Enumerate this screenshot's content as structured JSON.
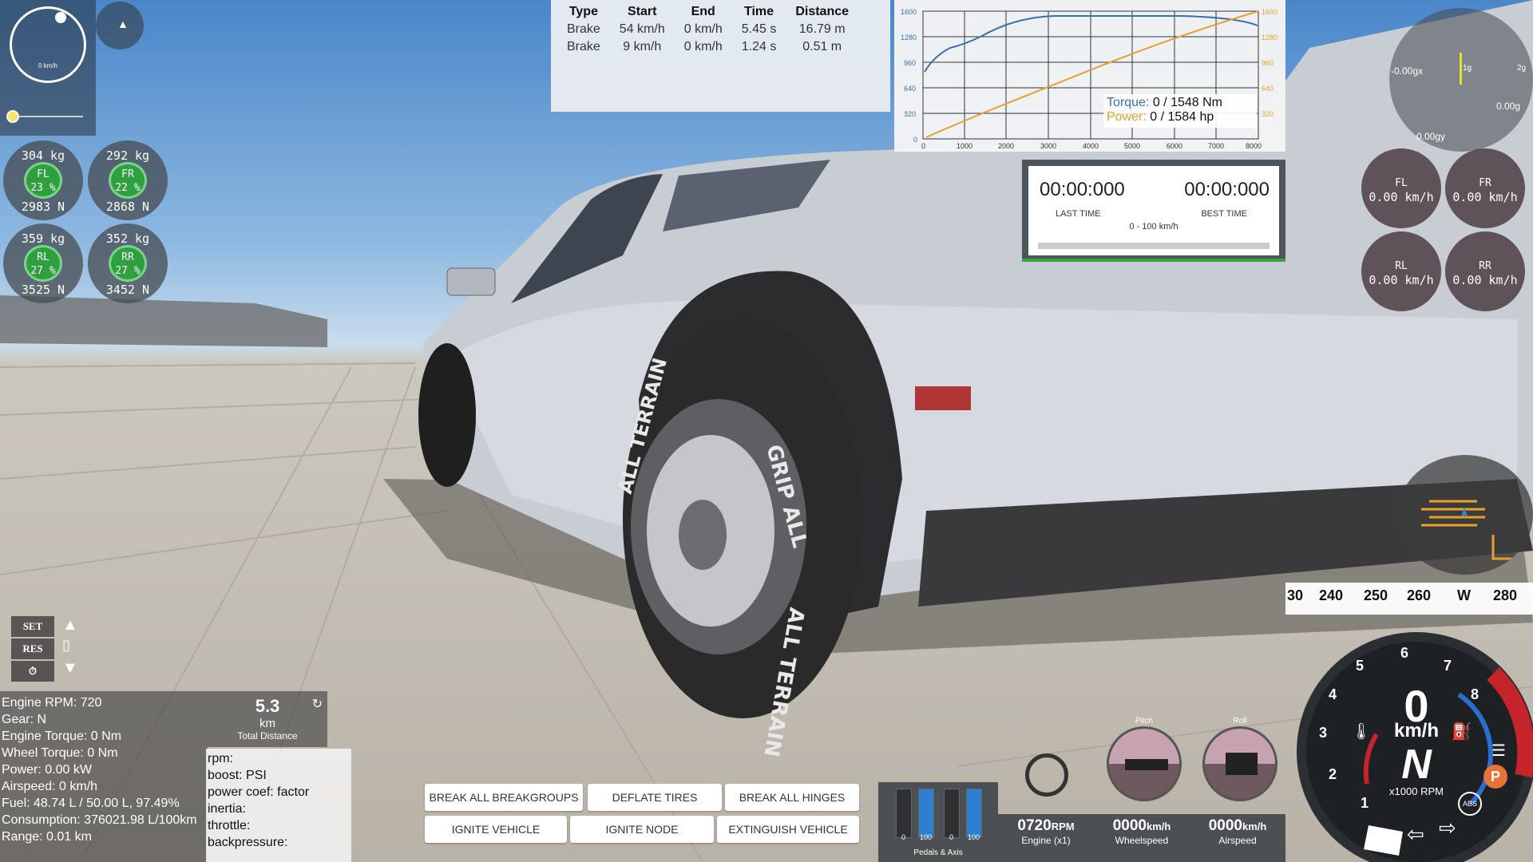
{
  "minimap": {
    "speed_label": "0 km/h"
  },
  "tyres": [
    {
      "id": "FL",
      "mass": "304 kg",
      "load": "23 %",
      "force": "2983 N"
    },
    {
      "id": "FR",
      "mass": "292 kg",
      "load": "22 %",
      "force": "2868 N"
    },
    {
      "id": "RL",
      "mass": "359 kg",
      "load": "27 %",
      "force": "3525 N"
    },
    {
      "id": "RR",
      "mass": "352 kg",
      "load": "27 %",
      "force": "3452 N"
    }
  ],
  "brake_table": {
    "headers": [
      "Type",
      "Start",
      "End",
      "Time",
      "Distance"
    ],
    "rows": [
      [
        "Brake",
        "54 km/h",
        "0 km/h",
        "5.45 s",
        "16.79 m"
      ],
      [
        "Brake",
        "9 km/h",
        "0 km/h",
        "1.24 s",
        "0.51 m"
      ]
    ]
  },
  "torque_graph": {
    "torque_label": "Torque:",
    "torque_value": "0 / 1548 Nm",
    "power_label": "Power:",
    "power_value": "0 / 1584 hp",
    "y_ticks": [
      "1600",
      "1280",
      "960",
      "640",
      "320",
      "0"
    ],
    "x_ticks": [
      "0",
      "1000",
      "2000",
      "3000",
      "4000",
      "5000",
      "6000",
      "7000",
      "8000"
    ],
    "colors": {
      "torque": "#3a6fb0",
      "power": "#e8a02c"
    }
  },
  "timer": {
    "last_time": "00:00:000",
    "last_label": "LAST TIME",
    "best_time": "00:00:000",
    "best_label": "BEST TIME",
    "mode": "0 - 100 km/h"
  },
  "gmeter": {
    "gx": "-0.00gx",
    "gz": "0.00g",
    "gy": "0.00gy",
    "scale1": "1g",
    "scale2": "2g"
  },
  "wheel_speeds": [
    {
      "id": "FL",
      "value": "0.00 km/h"
    },
    {
      "id": "FR",
      "value": "0.00 km/h"
    },
    {
      "id": "RL",
      "value": "0.00 km/h"
    },
    {
      "id": "RR",
      "value": "0.00 km/h"
    }
  ],
  "compass_tape": [
    "30",
    "240",
    "250",
    "260",
    "W",
    "280"
  ],
  "cruise": {
    "set": "SET",
    "res": "RES"
  },
  "stats": [
    "Engine RPM: 720",
    "Gear: N",
    "Engine Torque: 0 Nm",
    "Wheel Torque: 0 Nm",
    "Power: 0.00 kW",
    "Airspeed: 0 km/h",
    "Fuel: 48.74 L / 50.00 L, 97.49%",
    "Consumption: 376021.98 L/100km",
    "Range: 0.01 km"
  ],
  "distance": {
    "value": "5.3",
    "unit": "km",
    "label": "Total Distance"
  },
  "props": [
    "rpm:",
    "boost: PSI",
    "power coef: factor",
    "inertia:",
    "throttle:",
    "backpressure:"
  ],
  "actions": {
    "break_groups": "BREAK ALL BREAKGROUPS",
    "deflate": "DEFLATE TIRES",
    "break_hinges": "BREAK ALL HINGES",
    "ignite_vehicle": "IGNITE VEHICLE",
    "ignite_node": "IGNITE NODE",
    "extinguish": "EXTINGUISH VEHICLE"
  },
  "pedals": {
    "labels": [
      "0",
      "100",
      "0",
      "100"
    ],
    "title": "Pedals & Axis",
    "fills": [
      0,
      1,
      0,
      1
    ]
  },
  "readouts": {
    "rpm_value": "0720",
    "rpm_unit": "RPM",
    "rpm_label": "Engine (x1)",
    "wheel_value": "0000",
    "wheel_unit": "km/h",
    "wheel_label": "Wheelspeed",
    "air_value": "0000",
    "air_unit": "km/h",
    "air_label": "Airspeed"
  },
  "attitude": {
    "pitch": "Pitch",
    "roll": "Roll"
  },
  "gauge": {
    "speed": "0",
    "unit": "km/h",
    "gear": "N",
    "rpm_label": "x1000 RPM",
    "numbers": [
      "1",
      "2",
      "3",
      "4",
      "5",
      "6",
      "7",
      "8"
    ],
    "park": "P",
    "abs": "ABS"
  }
}
